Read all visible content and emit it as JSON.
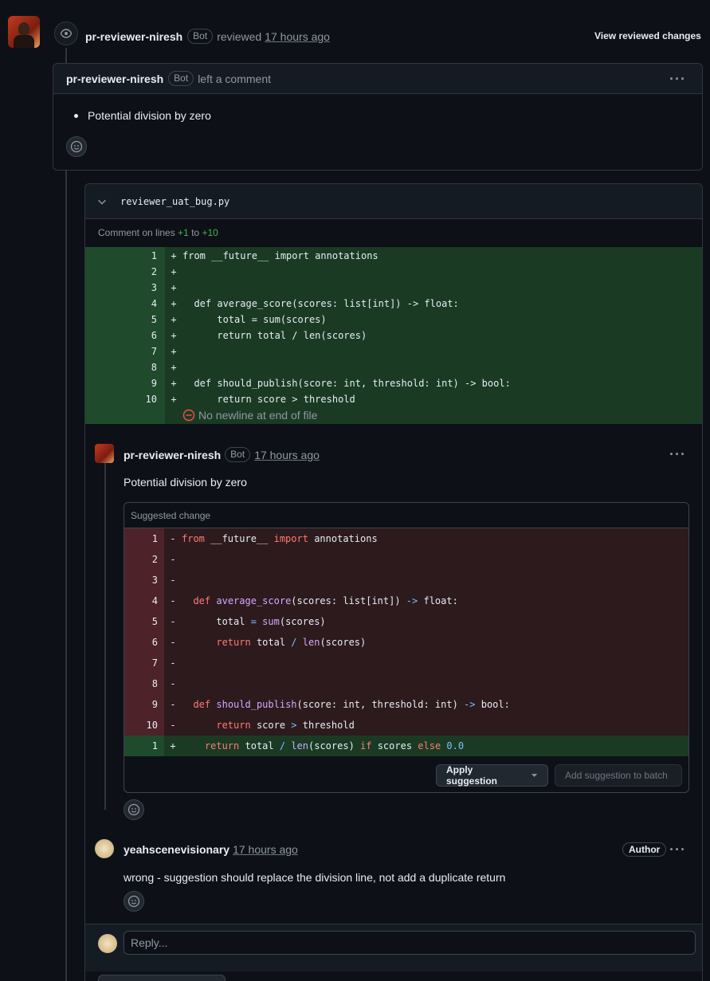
{
  "review_event": {
    "username": "pr-reviewer-niresh",
    "badge": "Bot",
    "action": "reviewed",
    "time": "17 hours ago",
    "view_changes_label": "View reviewed changes"
  },
  "review_comment": {
    "username": "pr-reviewer-niresh",
    "badge": "Bot",
    "action": "left a comment",
    "menu": "···",
    "bullet": "Potential division by zero"
  },
  "thread": {
    "filename": "reviewer_uat_bug.py",
    "lines_prefix": "Comment on lines",
    "line_start": "+1",
    "lines_to": "to",
    "line_end": "+10",
    "diff_lines": [
      {
        "num": "1",
        "sign": "+",
        "code": "from __future__ import annotations"
      },
      {
        "num": "2",
        "sign": "+",
        "code": ""
      },
      {
        "num": "3",
        "sign": "+",
        "code": ""
      },
      {
        "num": "4",
        "sign": "+",
        "code": "  def average_score(scores: list[int]) -> float:"
      },
      {
        "num": "5",
        "sign": "+",
        "code": "      total = sum(scores)"
      },
      {
        "num": "6",
        "sign": "+",
        "code": "      return total / len(scores)"
      },
      {
        "num": "7",
        "sign": "+",
        "code": ""
      },
      {
        "num": "8",
        "sign": "+",
        "code": ""
      },
      {
        "num": "9",
        "sign": "+",
        "code": "  def should_publish(score: int, threshold: int) -> bool:"
      },
      {
        "num": "10",
        "sign": "+",
        "code": "      return score > threshold"
      }
    ],
    "no_newline": "No newline at end of file",
    "comment1": {
      "username": "pr-reviewer-niresh",
      "badge": "Bot",
      "time": "17 hours ago",
      "body": "Potential division by zero",
      "suggested_label": "Suggested change",
      "del_lines": [
        {
          "num": "1",
          "sign": "-",
          "code": "from __future__ import annotations"
        },
        {
          "num": "2",
          "sign": "-",
          "code": ""
        },
        {
          "num": "3",
          "sign": "-",
          "code": ""
        },
        {
          "num": "4",
          "sign": "-",
          "code": "  def average_score(scores: list[int]) -> float:"
        },
        {
          "num": "5",
          "sign": "-",
          "code": "      total = sum(scores)"
        },
        {
          "num": "6",
          "sign": "-",
          "code": "      return total / len(scores)"
        },
        {
          "num": "7",
          "sign": "-",
          "code": ""
        },
        {
          "num": "8",
          "sign": "-",
          "code": ""
        },
        {
          "num": "9",
          "sign": "-",
          "code": "  def should_publish(score: int, threshold: int) -> bool:"
        },
        {
          "num": "10",
          "sign": "-",
          "code": "      return score > threshold"
        }
      ],
      "add_line": {
        "num": "1",
        "sign": "+",
        "code": "    return total / len(scores) if scores else 0.0"
      },
      "apply_label": "Apply suggestion",
      "batch_label": "Add suggestion to batch"
    },
    "comment2": {
      "username": "yeahscenevisionary",
      "time": "17 hours ago",
      "author_badge": "Author",
      "body": "wrong - suggestion should replace the division line, not add a duplicate return"
    },
    "reply_placeholder": "Reply..."
  },
  "colors": {
    "background": "#0d1117",
    "add_bg": "#1a3a24",
    "del_bg": "#2d1a1d",
    "accent_green": "#3fb950"
  }
}
